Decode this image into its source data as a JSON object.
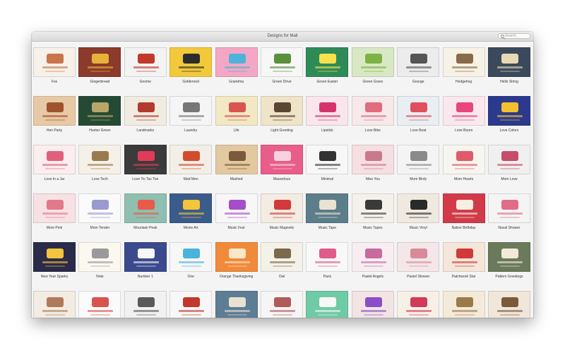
{
  "window": {
    "title": "Designs for Mail"
  },
  "search": {
    "placeholder": "Search"
  },
  "rows": [
    [
      {
        "name": "Fox",
        "bg": "#f6f1ea",
        "accent": "#c9744a"
      },
      {
        "name": "Gingerbread",
        "bg": "#8b3a2b",
        "accent": "#e8b13a"
      },
      {
        "name": "Gnome",
        "bg": "#f3f3f3",
        "accent": "#c0392b"
      },
      {
        "name": "Goldenrod",
        "bg": "#f1c93a",
        "accent": "#2d2d2d"
      },
      {
        "name": "Grandma",
        "bg": "#f4a7c4",
        "accent": "#4fb3d9"
      },
      {
        "name": "Green Drive",
        "bg": "#f7f7f7",
        "accent": "#5a8f3c"
      },
      {
        "name": "Green Easter",
        "bg": "#2e8b57",
        "accent": "#f7e14b"
      },
      {
        "name": "Green Grass",
        "bg": "#d9e8c4",
        "accent": "#7cb342"
      },
      {
        "name": "Grunge",
        "bg": "#ececec",
        "accent": "#555555"
      },
      {
        "name": "Hedgehog",
        "bg": "#f7f2e6",
        "accent": "#8a6a4a"
      },
      {
        "name": "Hello String",
        "bg": "#3a4a5c",
        "accent": "#e9d8b4"
      }
    ],
    [
      {
        "name": "Hen Party",
        "bg": "#e7c9a5",
        "accent": "#a0522d"
      },
      {
        "name": "Hunter Green",
        "bg": "#244a33",
        "accent": "#b9a56a"
      },
      {
        "name": "Landmarks",
        "bg": "#f1ece2",
        "accent": "#b23a2e"
      },
      {
        "name": "Laundry",
        "bg": "#f5f5f5",
        "accent": "#777777"
      },
      {
        "name": "Life",
        "bg": "#f2e8c4",
        "accent": "#d9534f"
      },
      {
        "name": "Light Greeting",
        "bg": "#efe3c8",
        "accent": "#5a4632"
      },
      {
        "name": "Lipstick",
        "bg": "#f8e6ec",
        "accent": "#d6336c"
      },
      {
        "name": "Love Bike",
        "bg": "#f7e8ea",
        "accent": "#e06c7e"
      },
      {
        "name": "Love Boat",
        "bg": "#e9eef2",
        "accent": "#e04f5f"
      },
      {
        "name": "Love Boom",
        "bg": "#fbe8ee",
        "accent": "#e8457a"
      },
      {
        "name": "Love Colors",
        "bg": "#2b3a8c",
        "accent": "#f2c12e"
      }
    ],
    [
      {
        "name": "Love In a Jar",
        "bg": "#fbeef0",
        "accent": "#e0607a"
      },
      {
        "name": "Love Tech",
        "bg": "#f5f1e8",
        "accent": "#9a7b4f"
      },
      {
        "name": "Love Tic Tac Toe",
        "bg": "#3b3b3b",
        "accent": "#e23b5a"
      },
      {
        "name": "Mad Men",
        "bg": "#f1efe8",
        "accent": "#d24d2e"
      },
      {
        "name": "Mashed",
        "bg": "#e3c9a0",
        "accent": "#7a5a3a"
      },
      {
        "name": "Mauvelous",
        "bg": "#e85d8a",
        "accent": "#f7d1df"
      },
      {
        "name": "Minimal",
        "bg": "#f7f7f7",
        "accent": "#333333"
      },
      {
        "name": "Miss You",
        "bg": "#f5dfe2",
        "accent": "#c97a8a"
      },
      {
        "name": "Mom Birdy",
        "bg": "#f4f4f4",
        "accent": "#8a8a8a"
      },
      {
        "name": "Mom Hearts",
        "bg": "#f7f5ef",
        "accent": "#e05a6a"
      },
      {
        "name": "Mom Love",
        "bg": "#f0f0f0",
        "accent": "#c44d6a"
      }
    ],
    [
      {
        "name": "Mom Pink",
        "bg": "#f7e1e5",
        "accent": "#e07a8a"
      },
      {
        "name": "Mom Tender",
        "bg": "#fafafa",
        "accent": "#9a9ad0"
      },
      {
        "name": "Mountain Peak",
        "bg": "#8fbfb0",
        "accent": "#e85a4a"
      },
      {
        "name": "Movie Art",
        "bg": "#3b5b8a",
        "accent": "#f2c53a"
      },
      {
        "name": "Music Fest",
        "bg": "#f7f7f7",
        "accent": "#a64ec8"
      },
      {
        "name": "Music Magnetic",
        "bg": "#f2ece2",
        "accent": "#d23a3a"
      },
      {
        "name": "Music Tape",
        "bg": "#5c7d8a",
        "accent": "#e9e2d0"
      },
      {
        "name": "Music Tapes",
        "bg": "#f4f1ea",
        "accent": "#3a3a3a"
      },
      {
        "name": "Music Vinyl",
        "bg": "#efe9df",
        "accent": "#2a2a2a"
      },
      {
        "name": "Native Birthday",
        "bg": "#d23a4a",
        "accent": "#f7efe1"
      },
      {
        "name": "Naval Shower",
        "bg": "#f4f4f4",
        "accent": "#e06c8a"
      }
    ],
    [
      {
        "name": "New Year Sparks",
        "bg": "#2a2a4a",
        "accent": "#f2c53a"
      },
      {
        "name": "Note",
        "bg": "#fbf8ef",
        "accent": "#9a9a9a"
      },
      {
        "name": "Number 1",
        "bg": "#3a4a8c",
        "accent": "#f7f7f7"
      },
      {
        "name": "One",
        "bg": "#f7f7f7",
        "accent": "#4ab3d9"
      },
      {
        "name": "Orange Thanksgiving",
        "bg": "#f08a3a",
        "accent": "#fce6c8"
      },
      {
        "name": "Owl",
        "bg": "#f4f1e8",
        "accent": "#7a6a4a"
      },
      {
        "name": "Paris",
        "bg": "#f8f8f8",
        "accent": "#e05a8a"
      },
      {
        "name": "Pastel Angels",
        "bg": "#f8eef2",
        "accent": "#c86aa0"
      },
      {
        "name": "Pastel Shower",
        "bg": "#f3e7e9",
        "accent": "#d98a9a"
      },
      {
        "name": "Patchwork Star",
        "bg": "#f4e6d9",
        "accent": "#d23a3a"
      },
      {
        "name": "Pattern Greetings",
        "bg": "#6a7a5a",
        "accent": "#f2ead8"
      }
    ],
    [
      {
        "name": "",
        "bg": "#f2ece2",
        "accent": "#b07a5a"
      },
      {
        "name": "",
        "bg": "#fafafa",
        "accent": "#d9534f"
      },
      {
        "name": "",
        "bg": "#f1f1f1",
        "accent": "#5a5a5a"
      },
      {
        "name": "",
        "bg": "#f7f7f7",
        "accent": "#c0392b"
      },
      {
        "name": "",
        "bg": "#5d7d94",
        "accent": "#e9e2d0"
      },
      {
        "name": "",
        "bg": "#f5f5f5",
        "accent": "#b05a5a"
      },
      {
        "name": "",
        "bg": "#6fcaa6",
        "accent": "#f7f7f7"
      },
      {
        "name": "",
        "bg": "#f3e4e4",
        "accent": "#8a4ec8"
      },
      {
        "name": "",
        "bg": "#f7f0e6",
        "accent": "#d23a5a"
      },
      {
        "name": "",
        "bg": "#f4ead9",
        "accent": "#9a7a4a"
      },
      {
        "name": "",
        "bg": "#f0e6da",
        "accent": "#7a5a3a"
      }
    ]
  ]
}
